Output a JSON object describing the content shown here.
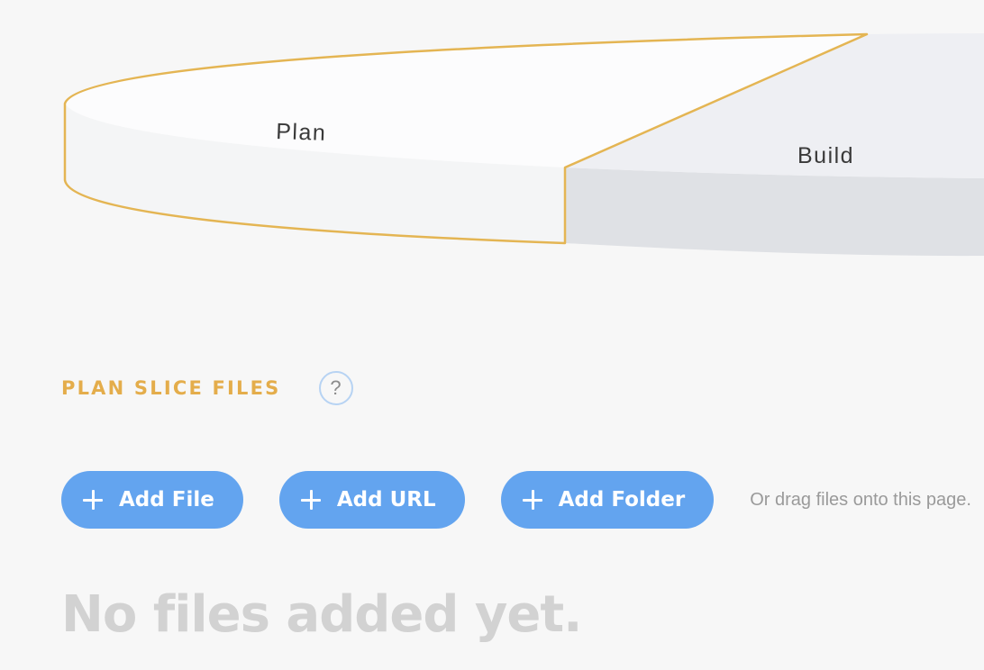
{
  "pie": {
    "slices": [
      {
        "label": "Plan",
        "selected": true
      },
      {
        "label": "Build",
        "selected": false
      }
    ],
    "colors": {
      "highlight": "#e4b553",
      "plan_top": "#fcfcfd",
      "plan_side": "#f4f5f6",
      "build_top": "#eeeff3",
      "build_side": "#dfe1e5"
    }
  },
  "section": {
    "title": "PLAN SLICE FILES",
    "help_symbol": "?"
  },
  "actions": {
    "add_file": "Add File",
    "add_url": "Add URL",
    "add_folder": "Add Folder",
    "drag_hint": "Or drag files onto this page."
  },
  "empty_state": "No files added yet."
}
